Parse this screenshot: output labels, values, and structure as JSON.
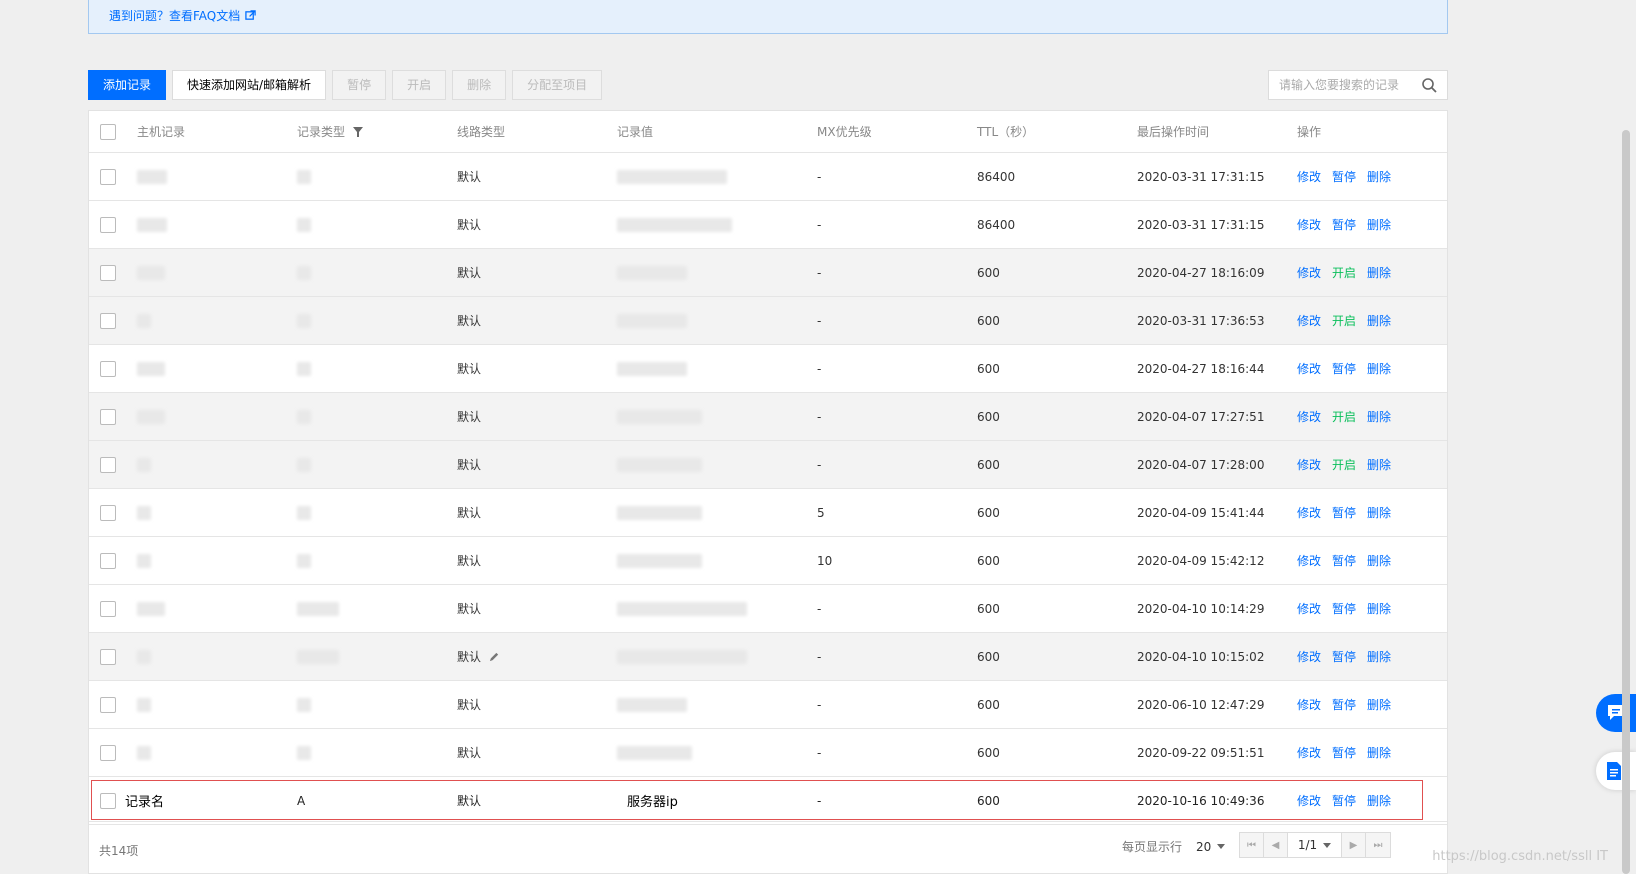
{
  "notice": {
    "faq_label": "遇到问题？查看FAQ文档"
  },
  "toolbar": {
    "add_label": "添加记录",
    "quick_add_label": "快速添加网站/邮箱解析",
    "pause_label": "暂停",
    "enable_label": "开启",
    "delete_label": "删除",
    "assign_label": "分配至项目"
  },
  "search": {
    "placeholder": "请输入您要搜索的记录"
  },
  "table": {
    "headers": {
      "host": "主机记录",
      "type": "记录类型",
      "line": "线路类型",
      "value": "记录值",
      "mx": "MX优先级",
      "ttl": "TTL（秒）",
      "time": "最后操作时间",
      "ops": "操作"
    },
    "rows": [
      {
        "line": "默认",
        "mx": "-",
        "ttl": "86400",
        "time": "2020-03-31 17:31:15",
        "op1": "修改",
        "op2": "暂停",
        "op3": "删除",
        "op2_state": "pause"
      },
      {
        "line": "默认",
        "mx": "-",
        "ttl": "86400",
        "time": "2020-03-31 17:31:15",
        "op1": "修改",
        "op2": "暂停",
        "op3": "删除",
        "op2_state": "pause"
      },
      {
        "line": "默认",
        "mx": "-",
        "ttl": "600",
        "time": "2020-04-27 18:16:09",
        "op1": "修改",
        "op2": "开启",
        "op3": "删除",
        "op2_state": "open"
      },
      {
        "line": "默认",
        "mx": "-",
        "ttl": "600",
        "time": "2020-03-31 17:36:53",
        "op1": "修改",
        "op2": "开启",
        "op3": "删除",
        "op2_state": "open"
      },
      {
        "line": "默认",
        "mx": "-",
        "ttl": "600",
        "time": "2020-04-27 18:16:44",
        "op1": "修改",
        "op2": "暂停",
        "op3": "删除",
        "op2_state": "pause"
      },
      {
        "line": "默认",
        "mx": "-",
        "ttl": "600",
        "time": "2020-04-07 17:27:51",
        "op1": "修改",
        "op2": "开启",
        "op3": "删除",
        "op2_state": "open"
      },
      {
        "line": "默认",
        "mx": "-",
        "ttl": "600",
        "time": "2020-04-07 17:28:00",
        "op1": "修改",
        "op2": "开启",
        "op3": "删除",
        "op2_state": "open"
      },
      {
        "line": "默认",
        "mx": "5",
        "ttl": "600",
        "time": "2020-04-09 15:41:44",
        "op1": "修改",
        "op2": "暂停",
        "op3": "删除",
        "op2_state": "pause"
      },
      {
        "line": "默认",
        "mx": "10",
        "ttl": "600",
        "time": "2020-04-09 15:42:12",
        "op1": "修改",
        "op2": "暂停",
        "op3": "删除",
        "op2_state": "pause"
      },
      {
        "line": "默认",
        "mx": "-",
        "ttl": "600",
        "time": "2020-04-10 10:14:29",
        "op1": "修改",
        "op2": "暂停",
        "op3": "删除",
        "op2_state": "pause"
      },
      {
        "line": "默认",
        "mx": "-",
        "ttl": "600",
        "time": "2020-04-10 10:15:02",
        "op1": "修改",
        "op2": "暂停",
        "op3": "删除",
        "op2_state": "pause"
      },
      {
        "line": "默认",
        "mx": "-",
        "ttl": "600",
        "time": "2020-06-10 12:47:29",
        "op1": "修改",
        "op2": "暂停",
        "op3": "删除",
        "op2_state": "pause"
      },
      {
        "line": "默认",
        "mx": "-",
        "ttl": "600",
        "time": "2020-09-22 09:51:51",
        "op1": "修改",
        "op2": "暂停",
        "op3": "删除",
        "op2_state": "pause"
      }
    ],
    "new_row": {
      "host": "记录名",
      "type": "A",
      "line": "默认",
      "value": "服务器ip",
      "mx": "-",
      "ttl": "600",
      "time": "2020-10-16 10:49:36",
      "op1": "修改",
      "op2": "暂停",
      "op3": "删除"
    }
  },
  "footer": {
    "total": "共14项",
    "per_page_label": "每页显示行",
    "per_page_value": "20",
    "page_value": "1/1"
  },
  "watermark": "https://blog.csdn.net/ssll IT",
  "colors": {
    "primary": "#006eff",
    "open": "#0abf5b",
    "highlight": "#e05050"
  }
}
